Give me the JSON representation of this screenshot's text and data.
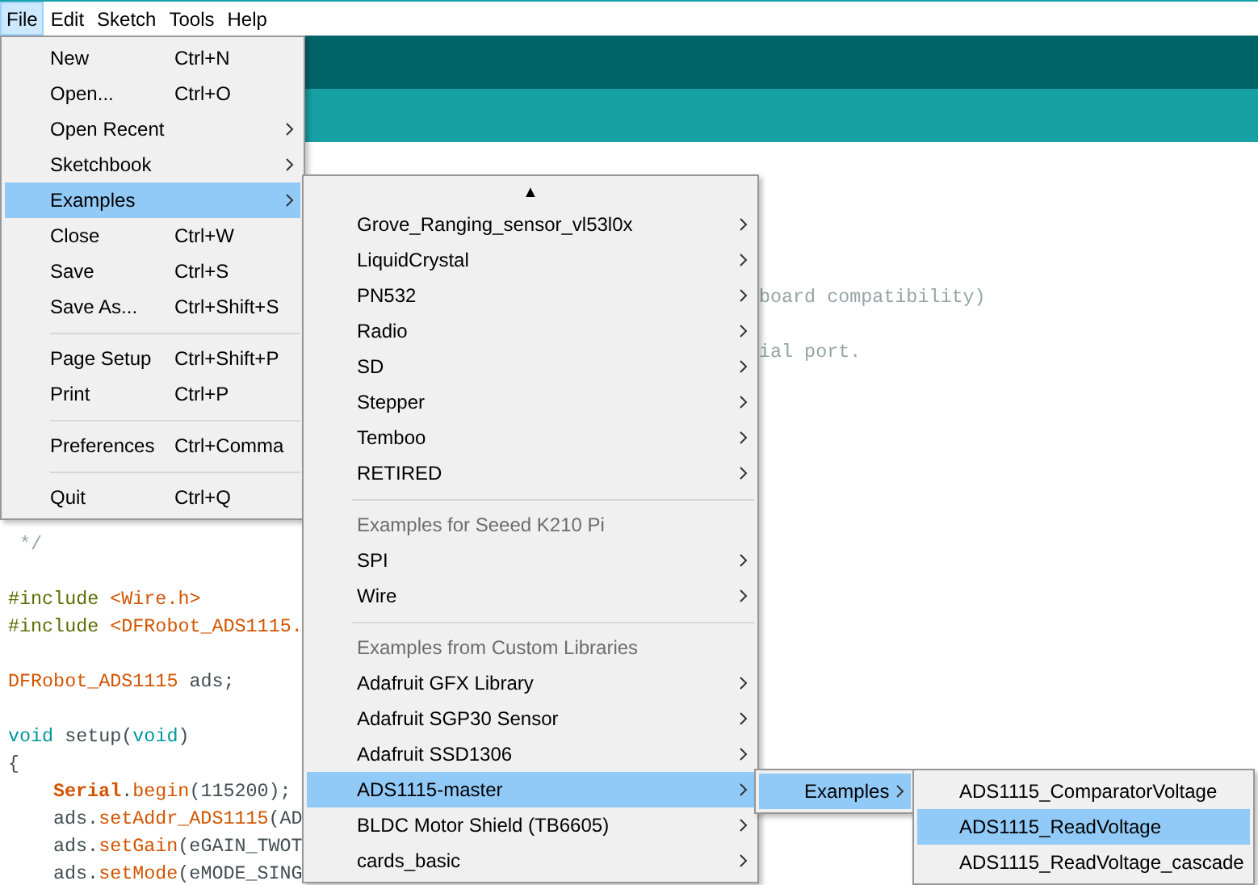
{
  "menubar": [
    {
      "label": "File",
      "selected": true
    },
    {
      "label": "Edit",
      "selected": false
    },
    {
      "label": "Sketch",
      "selected": false
    },
    {
      "label": "Tools",
      "selected": false
    },
    {
      "label": "Help",
      "selected": false
    }
  ],
  "editor": {
    "lines": [
      {
        "kind": "covered",
        "tokens": [
          {
            "text": "board compatibility)",
            "color": "#95a5a6"
          }
        ]
      },
      {
        "kind": "blank"
      },
      {
        "kind": "covered",
        "tokens": [
          {
            "text": "ial port.",
            "color": "#95a5a6"
          }
        ]
      },
      {
        "kind": "blank"
      },
      {
        "kind": "blank"
      },
      {
        "kind": "blank"
      },
      {
        "kind": "blank"
      },
      {
        "kind": "blank"
      },
      {
        "kind": "blank"
      },
      {
        "kind": "code",
        "tokens": [
          {
            "text": " */",
            "color": "#95a5a6"
          }
        ]
      },
      {
        "kind": "blank"
      },
      {
        "kind": "code",
        "tokens": [
          {
            "text": "#include ",
            "color": "#5e6d03"
          },
          {
            "text": "<Wire.h>",
            "color": "#d35400"
          }
        ]
      },
      {
        "kind": "code",
        "tokens": [
          {
            "text": "#include ",
            "color": "#5e6d03"
          },
          {
            "text": "<DFRobot_ADS1115.",
            "color": "#d35400"
          }
        ]
      },
      {
        "kind": "blank"
      },
      {
        "kind": "code",
        "tokens": [
          {
            "text": "DFRobot_ADS1115",
            "color": "#d35400"
          },
          {
            "text": " ads;",
            "color": "#434f54"
          }
        ]
      },
      {
        "kind": "blank"
      },
      {
        "kind": "code",
        "tokens": [
          {
            "text": "void",
            "color": "#00979c"
          },
          {
            "text": " setup(",
            "color": "#434f54"
          },
          {
            "text": "void",
            "color": "#00979c"
          },
          {
            "text": ")",
            "color": "#434f54"
          }
        ]
      },
      {
        "kind": "code",
        "tokens": [
          {
            "text": "{",
            "color": "#434f54"
          }
        ]
      },
      {
        "kind": "indented",
        "tokens": [
          {
            "text": "Serial",
            "color": "#d35400",
            "bold": true
          },
          {
            "text": ".",
            "color": "#434f54"
          },
          {
            "text": "begin",
            "color": "#d35400"
          },
          {
            "text": "(115200);",
            "color": "#434f54"
          }
        ]
      },
      {
        "kind": "indented",
        "tokens": [
          {
            "text": "ads.",
            "color": "#434f54"
          },
          {
            "text": "setAddr_ADS1115",
            "color": "#d35400"
          },
          {
            "text": "(AD",
            "color": "#434f54"
          }
        ]
      },
      {
        "kind": "indented",
        "tokens": [
          {
            "text": "ads.",
            "color": "#434f54"
          },
          {
            "text": "setGain",
            "color": "#d35400"
          },
          {
            "text": "(eGAIN_TWOT",
            "color": "#434f54"
          }
        ]
      },
      {
        "kind": "indented",
        "tokens": [
          {
            "text": "ads.",
            "color": "#434f54"
          },
          {
            "text": "setMode",
            "color": "#d35400"
          },
          {
            "text": "(eMODE_SING",
            "color": "#434f54"
          }
        ]
      }
    ]
  },
  "file_menu": {
    "items": [
      {
        "kind": "item",
        "label": "New",
        "shortcut": "Ctrl+N",
        "submenu": false,
        "selected": false
      },
      {
        "kind": "item",
        "label": "Open...",
        "shortcut": "Ctrl+O",
        "submenu": false,
        "selected": false
      },
      {
        "kind": "item",
        "label": "Open Recent",
        "submenu": true,
        "selected": false
      },
      {
        "kind": "item",
        "label": "Sketchbook",
        "submenu": true,
        "selected": false
      },
      {
        "kind": "item",
        "label": "Examples",
        "submenu": true,
        "selected": true
      },
      {
        "kind": "item",
        "label": "Close",
        "shortcut": "Ctrl+W",
        "submenu": false,
        "selected": false
      },
      {
        "kind": "item",
        "label": "Save",
        "shortcut": "Ctrl+S",
        "submenu": false,
        "selected": false
      },
      {
        "kind": "item",
        "label": "Save As...",
        "shortcut": "Ctrl+Shift+S",
        "submenu": false,
        "selected": false
      },
      {
        "kind": "separator"
      },
      {
        "kind": "item",
        "label": "Page Setup",
        "shortcut": "Ctrl+Shift+P",
        "submenu": false,
        "selected": false
      },
      {
        "kind": "item",
        "label": "Print",
        "shortcut": "Ctrl+P",
        "submenu": false,
        "selected": false
      },
      {
        "kind": "separator"
      },
      {
        "kind": "item",
        "label": "Preferences",
        "shortcut": "Ctrl+Comma",
        "submenu": false,
        "selected": false
      },
      {
        "kind": "separator"
      },
      {
        "kind": "item",
        "label": "Quit",
        "shortcut": "Ctrl+Q",
        "submenu": false,
        "selected": false
      }
    ]
  },
  "examples_menu": {
    "scroll_up": "▲",
    "items": [
      {
        "kind": "item",
        "label": "Grove_Ranging_sensor_vl53l0x",
        "submenu": true,
        "selected": false
      },
      {
        "kind": "item",
        "label": "LiquidCrystal",
        "submenu": true,
        "selected": false
      },
      {
        "kind": "item",
        "label": "PN532",
        "submenu": true,
        "selected": false
      },
      {
        "kind": "item",
        "label": "Radio",
        "submenu": true,
        "selected": false
      },
      {
        "kind": "item",
        "label": "SD",
        "submenu": true,
        "selected": false
      },
      {
        "kind": "item",
        "label": "Stepper",
        "submenu": true,
        "selected": false
      },
      {
        "kind": "item",
        "label": "Temboo",
        "submenu": true,
        "selected": false
      },
      {
        "kind": "item",
        "label": "RETIRED",
        "submenu": true,
        "selected": false
      },
      {
        "kind": "separator"
      },
      {
        "kind": "header",
        "label": "Examples for Seeed K210 Pi"
      },
      {
        "kind": "item",
        "label": "SPI",
        "submenu": true,
        "selected": false
      },
      {
        "kind": "item",
        "label": "Wire",
        "submenu": true,
        "selected": false
      },
      {
        "kind": "separator"
      },
      {
        "kind": "header",
        "label": "Examples from Custom Libraries"
      },
      {
        "kind": "item",
        "label": "Adafruit GFX Library",
        "submenu": true,
        "selected": false
      },
      {
        "kind": "item",
        "label": "Adafruit SGP30 Sensor",
        "submenu": true,
        "selected": false
      },
      {
        "kind": "item",
        "label": "Adafruit SSD1306",
        "submenu": true,
        "selected": false
      },
      {
        "kind": "item",
        "label": "ADS1115-master",
        "submenu": true,
        "selected": true
      },
      {
        "kind": "item",
        "label": "BLDC Motor Shield (TB6605)",
        "submenu": true,
        "selected": false
      },
      {
        "kind": "item",
        "label": "cards_basic",
        "submenu": true,
        "selected": false
      }
    ]
  },
  "library_menu": {
    "items": [
      {
        "kind": "item",
        "label": "Examples",
        "submenu": true,
        "selected": true
      }
    ]
  },
  "sketch_menu": {
    "items": [
      {
        "kind": "item",
        "label": "ADS1115_ComparatorVoltage",
        "submenu": false,
        "selected": false
      },
      {
        "kind": "item",
        "label": "ADS1115_ReadVoltage",
        "submenu": false,
        "selected": true
      },
      {
        "kind": "item",
        "label": "ADS1115_ReadVoltage_cascade",
        "submenu": false,
        "selected": false
      }
    ]
  }
}
